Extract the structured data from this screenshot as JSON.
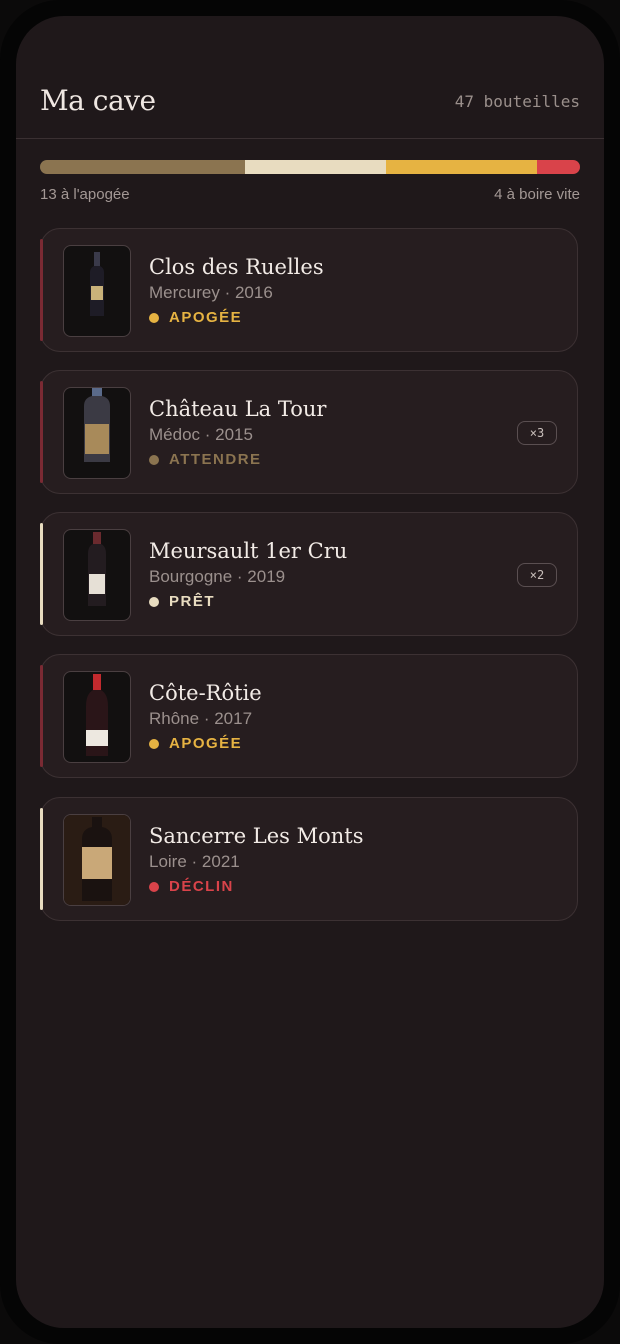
{
  "header": {
    "title": "Ma cave",
    "count": "47 bouteilles"
  },
  "summary": {
    "left_label": "13 à l'apogée",
    "right_label": "4 à boire vite",
    "segments": [
      {
        "name": "attendre",
        "fraction": 0.38,
        "color": "#8b7450"
      },
      {
        "name": "pret",
        "fraction": 0.26,
        "color": "#e8dcc0"
      },
      {
        "name": "apogee",
        "fraction": 0.28,
        "color": "#e6b342"
      },
      {
        "name": "declin",
        "fraction": 0.08,
        "color": "#d9434a"
      }
    ]
  },
  "wines": [
    {
      "name": "Clos des Ruelles",
      "region": "Mercurey",
      "year": "2016",
      "sub": "Mercurey · 2016",
      "status": "APOGÉE",
      "status_color": "#e6b342",
      "accent": "#7a2a33",
      "qty": ""
    },
    {
      "name": "Château La Tour",
      "region": "Médoc",
      "year": "2015",
      "sub": "Médoc · 2015",
      "status": "ATTENDRE",
      "status_color": "#8b7450",
      "accent": "#7a2a33",
      "qty": "×3"
    },
    {
      "name": "Meursault 1er Cru",
      "region": "Bourgogne",
      "year": "2019",
      "sub": "Bourgogne · 2019",
      "status": "PRÊT",
      "status_color": "#e8dcc0",
      "accent": "#e8dcc0",
      "qty": "×2"
    },
    {
      "name": "Côte-Rôtie",
      "region": "Rhône",
      "year": "2017",
      "sub": "Rhône · 2017",
      "status": "APOGÉE",
      "status_color": "#e6b342",
      "accent": "#7a2a33",
      "qty": ""
    },
    {
      "name": "Sancerre Les Monts",
      "region": "Loire",
      "year": "2021",
      "sub": "Loire · 2021",
      "status": "DÉCLIN",
      "status_color": "#d9434a",
      "accent": "#e8dcc0",
      "qty": ""
    }
  ]
}
